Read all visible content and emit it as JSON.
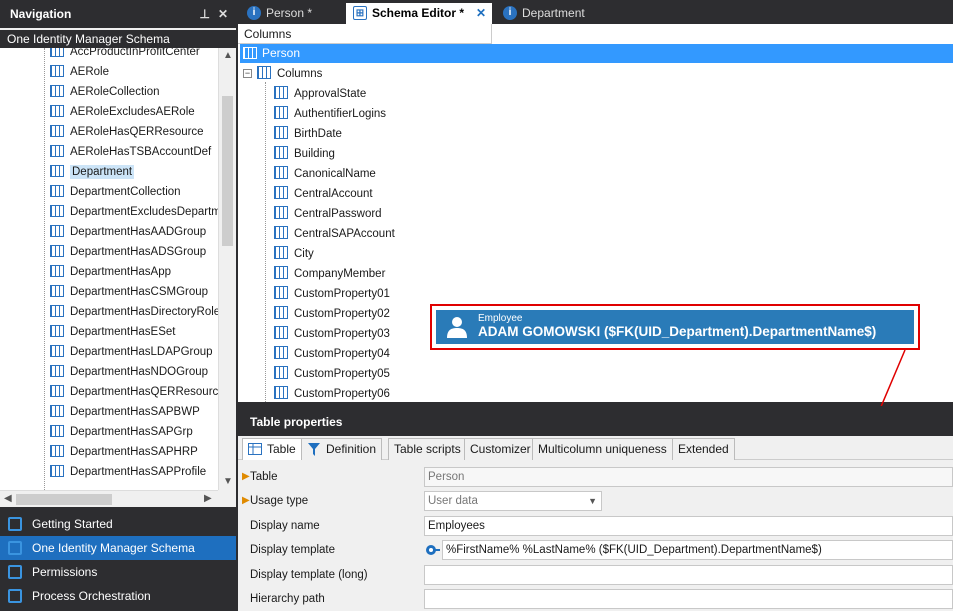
{
  "nav": {
    "title": "Navigation",
    "subtitle": "One Identity Manager Schema",
    "tree_items": [
      "AccProductInProfitCenter",
      "AERole",
      "AERoleCollection",
      "AERoleExcludesAERole",
      "AERoleHasQERResource",
      "AERoleHasTSBAccountDef",
      "Department",
      "DepartmentCollection",
      "DepartmentExcludesDepartm",
      "DepartmentHasAADGroup",
      "DepartmentHasADSGroup",
      "DepartmentHasApp",
      "DepartmentHasCSMGroup",
      "DepartmentHasDirectoryRole",
      "DepartmentHasESet",
      "DepartmentHasLDAPGroup",
      "DepartmentHasNDOGroup",
      "DepartmentHasQERResource",
      "DepartmentHasSAPBWP",
      "DepartmentHasSAPGrp",
      "DepartmentHasSAPHRP",
      "DepartmentHasSAPProfile"
    ],
    "selected_item": "Department",
    "bottom_buttons": [
      "Getting Started",
      "One Identity Manager Schema",
      "Permissions",
      "Process Orchestration"
    ],
    "active_button": "One Identity Manager Schema"
  },
  "tabs": [
    {
      "label": "Person *",
      "icon": "info-icon"
    },
    {
      "label": "Schema Editor *",
      "icon": "schema-icon"
    },
    {
      "label": "Department",
      "icon": "info-icon"
    }
  ],
  "active_tab": "Schema Editor *",
  "columns_panel": {
    "header": "Columns",
    "table_name": "Person",
    "group_label": "Columns",
    "columns": [
      "ApprovalState",
      "AuthentifierLogins",
      "BirthDate",
      "Building",
      "CanonicalName",
      "CentralAccount",
      "CentralPassword",
      "CentralSAPAccount",
      "City",
      "CompanyMember",
      "CustomProperty01",
      "CustomProperty02",
      "CustomProperty03",
      "CustomProperty04",
      "CustomProperty05",
      "CustomProperty06"
    ]
  },
  "callout": {
    "label": "Employee",
    "value": "ADAM GOMOWSKI ($FK(UID_Department).DepartmentName$)",
    "border_color": "#e00000"
  },
  "table_properties": {
    "title": "Table properties",
    "tabs": [
      "Table",
      "Definition",
      "Table scripts",
      "Customizer",
      "Multicolumn uniqueness",
      "Extended"
    ],
    "active_tab": "Table",
    "rows": [
      {
        "label": "Table",
        "value": "Person",
        "marked": true
      },
      {
        "label": "Usage type",
        "value": "User data",
        "marked": true
      },
      {
        "label": "Display name",
        "value": "Employees",
        "marked": false
      },
      {
        "label": "Display template",
        "value": "%FirstName% %LastName% ($FK(UID_Department).DepartmentName$)",
        "marked": false
      },
      {
        "label": "Display template (long)",
        "value": "",
        "marked": false
      },
      {
        "label": "Hierarchy path",
        "value": "",
        "marked": false
      }
    ]
  },
  "colors": {
    "accent": "#1e6fbf",
    "selection": "#3399ff",
    "callout_bg": "#2a7bb8",
    "dark_bg": "#2d2d30"
  }
}
